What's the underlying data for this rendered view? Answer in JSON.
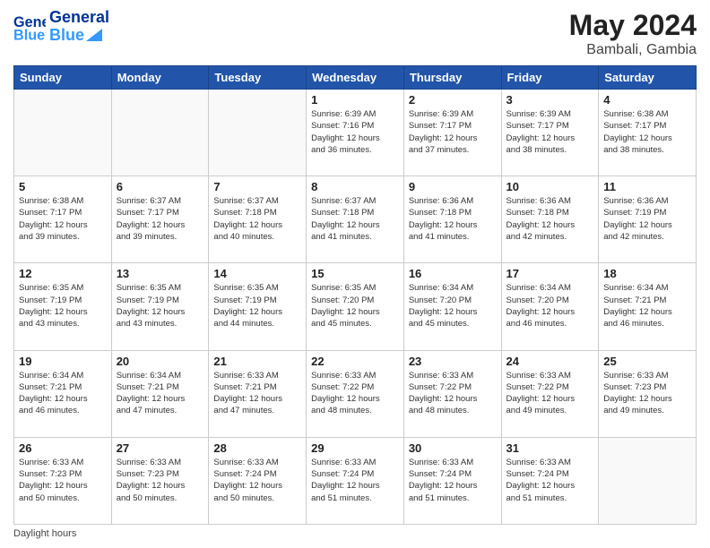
{
  "header": {
    "logo_general": "General",
    "logo_blue": "Blue",
    "title": "May 2024",
    "subtitle": "Bambali, Gambia"
  },
  "days_of_week": [
    "Sunday",
    "Monday",
    "Tuesday",
    "Wednesday",
    "Thursday",
    "Friday",
    "Saturday"
  ],
  "weeks": [
    [
      {
        "day": "",
        "info": ""
      },
      {
        "day": "",
        "info": ""
      },
      {
        "day": "",
        "info": ""
      },
      {
        "day": "1",
        "info": "Sunrise: 6:39 AM\nSunset: 7:16 PM\nDaylight: 12 hours\nand 36 minutes."
      },
      {
        "day": "2",
        "info": "Sunrise: 6:39 AM\nSunset: 7:17 PM\nDaylight: 12 hours\nand 37 minutes."
      },
      {
        "day": "3",
        "info": "Sunrise: 6:39 AM\nSunset: 7:17 PM\nDaylight: 12 hours\nand 38 minutes."
      },
      {
        "day": "4",
        "info": "Sunrise: 6:38 AM\nSunset: 7:17 PM\nDaylight: 12 hours\nand 38 minutes."
      }
    ],
    [
      {
        "day": "5",
        "info": "Sunrise: 6:38 AM\nSunset: 7:17 PM\nDaylight: 12 hours\nand 39 minutes."
      },
      {
        "day": "6",
        "info": "Sunrise: 6:37 AM\nSunset: 7:17 PM\nDaylight: 12 hours\nand 39 minutes."
      },
      {
        "day": "7",
        "info": "Sunrise: 6:37 AM\nSunset: 7:18 PM\nDaylight: 12 hours\nand 40 minutes."
      },
      {
        "day": "8",
        "info": "Sunrise: 6:37 AM\nSunset: 7:18 PM\nDaylight: 12 hours\nand 41 minutes."
      },
      {
        "day": "9",
        "info": "Sunrise: 6:36 AM\nSunset: 7:18 PM\nDaylight: 12 hours\nand 41 minutes."
      },
      {
        "day": "10",
        "info": "Sunrise: 6:36 AM\nSunset: 7:18 PM\nDaylight: 12 hours\nand 42 minutes."
      },
      {
        "day": "11",
        "info": "Sunrise: 6:36 AM\nSunset: 7:19 PM\nDaylight: 12 hours\nand 42 minutes."
      }
    ],
    [
      {
        "day": "12",
        "info": "Sunrise: 6:35 AM\nSunset: 7:19 PM\nDaylight: 12 hours\nand 43 minutes."
      },
      {
        "day": "13",
        "info": "Sunrise: 6:35 AM\nSunset: 7:19 PM\nDaylight: 12 hours\nand 43 minutes."
      },
      {
        "day": "14",
        "info": "Sunrise: 6:35 AM\nSunset: 7:19 PM\nDaylight: 12 hours\nand 44 minutes."
      },
      {
        "day": "15",
        "info": "Sunrise: 6:35 AM\nSunset: 7:20 PM\nDaylight: 12 hours\nand 45 minutes."
      },
      {
        "day": "16",
        "info": "Sunrise: 6:34 AM\nSunset: 7:20 PM\nDaylight: 12 hours\nand 45 minutes."
      },
      {
        "day": "17",
        "info": "Sunrise: 6:34 AM\nSunset: 7:20 PM\nDaylight: 12 hours\nand 46 minutes."
      },
      {
        "day": "18",
        "info": "Sunrise: 6:34 AM\nSunset: 7:21 PM\nDaylight: 12 hours\nand 46 minutes."
      }
    ],
    [
      {
        "day": "19",
        "info": "Sunrise: 6:34 AM\nSunset: 7:21 PM\nDaylight: 12 hours\nand 46 minutes."
      },
      {
        "day": "20",
        "info": "Sunrise: 6:34 AM\nSunset: 7:21 PM\nDaylight: 12 hours\nand 47 minutes."
      },
      {
        "day": "21",
        "info": "Sunrise: 6:33 AM\nSunset: 7:21 PM\nDaylight: 12 hours\nand 47 minutes."
      },
      {
        "day": "22",
        "info": "Sunrise: 6:33 AM\nSunset: 7:22 PM\nDaylight: 12 hours\nand 48 minutes."
      },
      {
        "day": "23",
        "info": "Sunrise: 6:33 AM\nSunset: 7:22 PM\nDaylight: 12 hours\nand 48 minutes."
      },
      {
        "day": "24",
        "info": "Sunrise: 6:33 AM\nSunset: 7:22 PM\nDaylight: 12 hours\nand 49 minutes."
      },
      {
        "day": "25",
        "info": "Sunrise: 6:33 AM\nSunset: 7:23 PM\nDaylight: 12 hours\nand 49 minutes."
      }
    ],
    [
      {
        "day": "26",
        "info": "Sunrise: 6:33 AM\nSunset: 7:23 PM\nDaylight: 12 hours\nand 50 minutes."
      },
      {
        "day": "27",
        "info": "Sunrise: 6:33 AM\nSunset: 7:23 PM\nDaylight: 12 hours\nand 50 minutes."
      },
      {
        "day": "28",
        "info": "Sunrise: 6:33 AM\nSunset: 7:24 PM\nDaylight: 12 hours\nand 50 minutes."
      },
      {
        "day": "29",
        "info": "Sunrise: 6:33 AM\nSunset: 7:24 PM\nDaylight: 12 hours\nand 51 minutes."
      },
      {
        "day": "30",
        "info": "Sunrise: 6:33 AM\nSunset: 7:24 PM\nDaylight: 12 hours\nand 51 minutes."
      },
      {
        "day": "31",
        "info": "Sunrise: 6:33 AM\nSunset: 7:24 PM\nDaylight: 12 hours\nand 51 minutes."
      },
      {
        "day": "",
        "info": ""
      }
    ]
  ],
  "footer": {
    "note": "Daylight hours"
  }
}
